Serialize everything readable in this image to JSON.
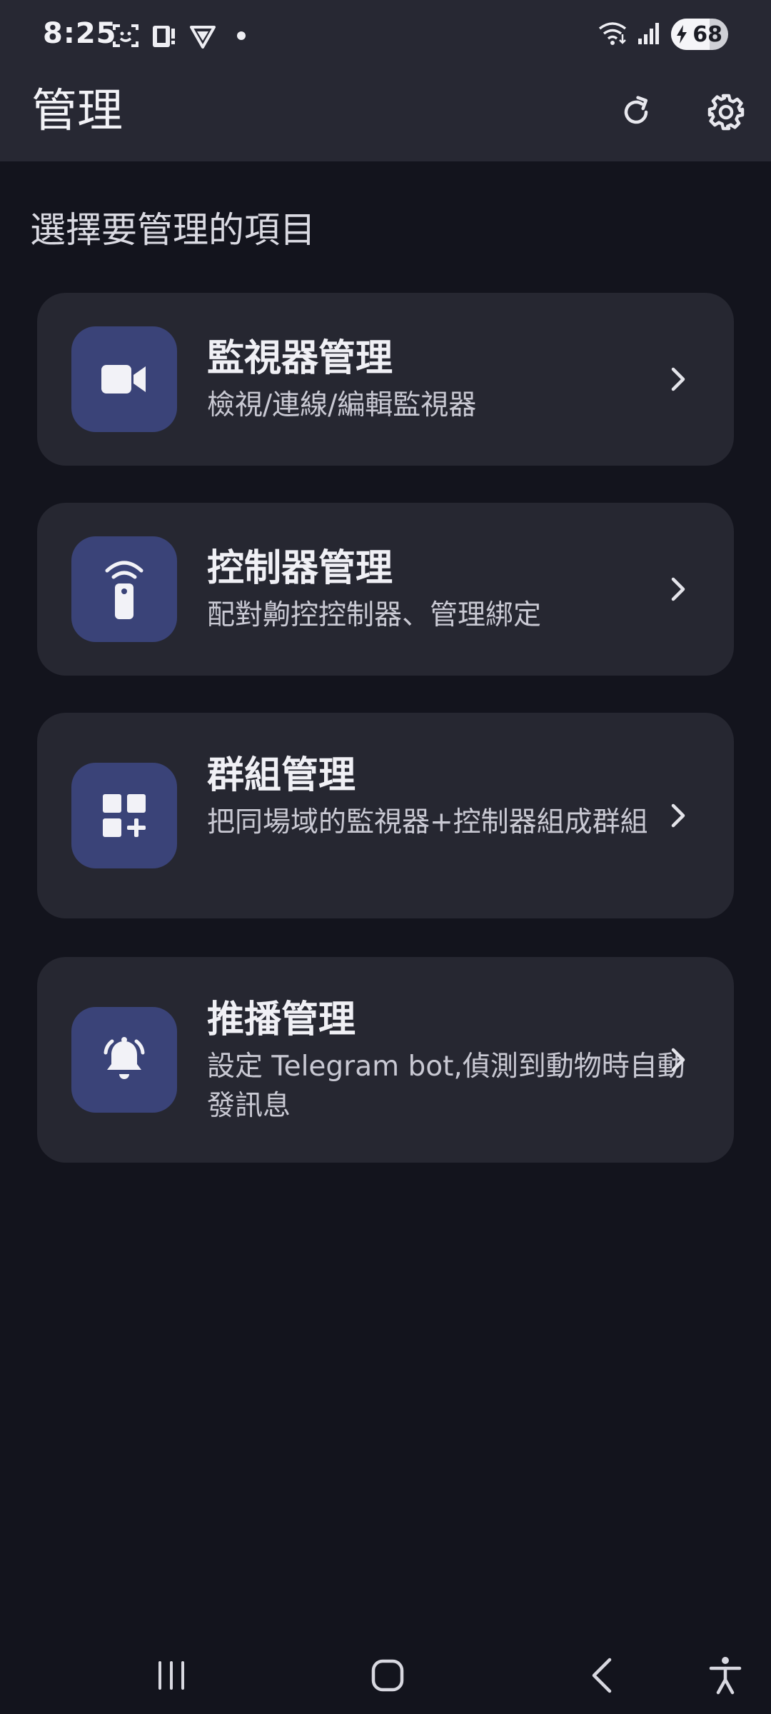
{
  "status_bar": {
    "time": "8:25",
    "battery": "68",
    "battery_level": 0.68,
    "left_icons": [
      "face-scan-icon",
      "phone-alert-icon",
      "vpn-shield-icon",
      "dot-icon"
    ],
    "right_icons": [
      "wifi-icon",
      "signal-icon",
      "battery-icon"
    ]
  },
  "app_bar": {
    "title": "管理",
    "actions": [
      "refresh-icon",
      "gear-icon"
    ]
  },
  "section_heading": "選擇要管理的項目",
  "cards": [
    {
      "title": "監視器管理",
      "description": "檢視/連線/編輯監視器",
      "icon": "video-camera-icon"
    },
    {
      "title": "控制器管理",
      "description": "配對齁控控制器、管理綁定",
      "icon": "remote-control-icon"
    },
    {
      "title": "群組管理",
      "description": "把同場域的監視器+控制器組成群組",
      "icon": "add-group-icon"
    },
    {
      "title": "推播管理",
      "description": "設定 Telegram bot,偵測到動物時自動發訊息",
      "icon": "bell-ringing-icon"
    }
  ],
  "nav_bar": {
    "buttons": [
      "recent-apps-icon",
      "home-icon",
      "back-icon",
      "accessibility-icon"
    ]
  },
  "colors": {
    "background": "#13141d",
    "surface": "#272833",
    "card": "#262731",
    "icon_tile": "#3a4378",
    "text_primary": "#f0f0f5",
    "text_secondary": "#c9c9d3"
  }
}
